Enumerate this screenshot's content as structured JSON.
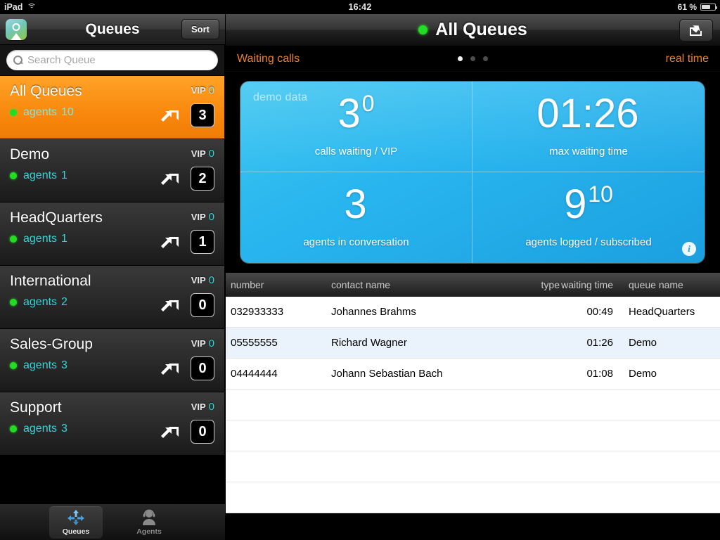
{
  "status_bar": {
    "carrier": "iPad",
    "wifi_icon": "wifi-icon",
    "time": "16:42",
    "battery": "61 %"
  },
  "sidebar": {
    "nav": {
      "logo_icon": "app-logo-icon",
      "title": "Queues",
      "sort_label": "Sort"
    },
    "search": {
      "icon": "search-icon",
      "placeholder": "Search Queue",
      "value": ""
    },
    "vip_label": "VIP",
    "agents_label": "agents",
    "queues": [
      {
        "name": "All Queues",
        "status": "online",
        "agents": "10",
        "vip": "0",
        "count": "3",
        "selected": true
      },
      {
        "name": "Demo",
        "status": "online",
        "agents": "1",
        "vip": "0",
        "count": "2",
        "selected": false
      },
      {
        "name": "HeadQuarters",
        "status": "online",
        "agents": "1",
        "vip": "0",
        "count": "1",
        "selected": false
      },
      {
        "name": "International",
        "status": "online",
        "agents": "2",
        "vip": "0",
        "count": "0",
        "selected": false
      },
      {
        "name": "Sales-Group",
        "status": "online",
        "agents": "3",
        "vip": "0",
        "count": "0",
        "selected": false
      },
      {
        "name": "Support",
        "status": "online",
        "agents": "3",
        "vip": "0",
        "count": "0",
        "selected": false
      }
    ],
    "tabs": [
      {
        "label": "Queues",
        "icon": "queues-arrows-icon",
        "selected": true
      },
      {
        "label": "Agents",
        "icon": "agent-headset-icon",
        "selected": false
      }
    ]
  },
  "main": {
    "nav": {
      "status": "online",
      "title": "All Queues",
      "share_icon": "share-icon"
    },
    "subbar": {
      "left": "Waiting calls",
      "right": "real time",
      "pages": 3,
      "active_page": 1
    },
    "stats": {
      "watermark": "demo data",
      "info_icon": "info-icon",
      "cells": [
        {
          "value": "3",
          "sup": "0",
          "label": "calls waiting / VIP"
        },
        {
          "value": "01:26",
          "sup": "",
          "label": "max waiting time"
        },
        {
          "value": "3",
          "sup": "",
          "label": "agents in conversation"
        },
        {
          "value": "9",
          "sup": "10",
          "label": "agents logged / subscribed"
        }
      ]
    },
    "table": {
      "headers": {
        "number": "number",
        "contact": "contact name",
        "type": "type",
        "waiting": "waiting time",
        "queue": "queue name"
      },
      "rows": [
        {
          "number": "032933333",
          "contact": "Johannes Brahms",
          "type": "",
          "waiting": "00:49",
          "queue": "HeadQuarters"
        },
        {
          "number": "05555555",
          "contact": "Richard Wagner",
          "type": "",
          "waiting": "01:26",
          "queue": "Demo"
        },
        {
          "number": "04444444",
          "contact": "Johann Sebastian Bach",
          "type": "",
          "waiting": "01:08",
          "queue": "Demo"
        }
      ]
    }
  },
  "colors": {
    "accent_orange": "#f0821e",
    "cyan": "#2fd8d8",
    "status_green": "#22dd22",
    "card_blue": "#29b6ef"
  }
}
